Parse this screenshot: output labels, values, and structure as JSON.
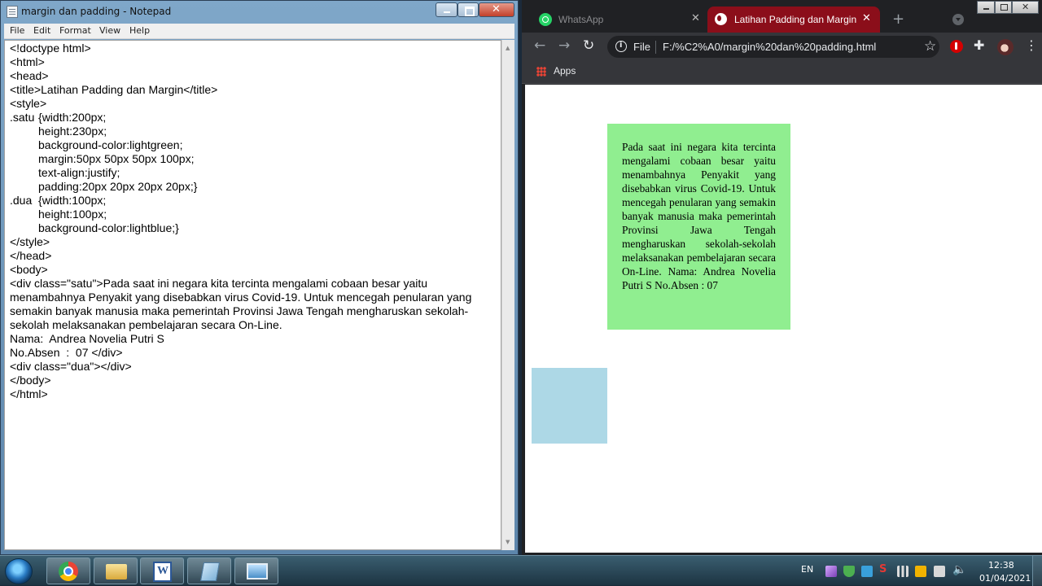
{
  "notepad": {
    "title": "margin dan padding - Notepad",
    "menu": [
      "File",
      "Edit",
      "Format",
      "View",
      "Help"
    ],
    "content": "<!doctype html>\n<html>\n<head>\n<title>Latihan Padding dan Margin</title>\n<style>\n.satu\t{width:200px;\n\theight:230px;\n\tbackground-color:lightgreen;\n\tmargin:50px 50px 50px 100px;\n\ttext-align:justify;\n\tpadding:20px 20px 20px 20px;}\n.dua\t{width:100px;\n\theight:100px;\n\tbackground-color:lightblue;}\n</style>\n</head>\n<body>\n<div class=\"satu\">Pada saat ini negara kita tercinta mengalami cobaan besar yaitu\nmenambahnya Penyakit yang disebabkan virus Covid-19. Untuk mencegah penularan yang\nsemakin banyak manusia maka pemerintah Provinsi Jawa Tengah mengharuskan sekolah-\nsekolah melaksanakan pembelajaran secara On-Line.\nNama:  Andrea Novelia Putri S\nNo.Absen  :  07 </div>\n<div class=\"dua\"></div>\n</body>\n</html>"
  },
  "browser": {
    "tabs": [
      {
        "label": "WhatsApp",
        "active": false,
        "icon": "whatsapp-icon"
      },
      {
        "label": "Latihan Padding dan Margin",
        "active": true,
        "icon": "globe-icon"
      }
    ],
    "omnibox": {
      "scheme": "File",
      "url": "F:/%C2%A0/margin%20dan%20padding.html"
    },
    "bookmarks": {
      "apps_label": "Apps"
    },
    "page": {
      "satu_text": "Pada saat ini negara kita tercinta mengalami cobaan besar yaitu menambahnya Penyakit yang disebabkan virus Covid-19. Untuk mencegah penularan yang semakin banyak manusia maka pemerintah Provinsi Jawa Tengah mengharuskan sekolah-sekolah melaksanakan pembelajaran secara On-Line. Nama: Andrea Novelia Putri S No.Absen : 07",
      "satu_color": "#90ee90",
      "dua_color": "#add8e6"
    },
    "active_tab_color": "#8b0e1a"
  },
  "taskbar": {
    "apps": [
      "chrome-icon",
      "explorer-icon",
      "word-icon",
      "notepad-icon",
      "photo-icon"
    ],
    "language": "EN",
    "time": "12:38",
    "date": "01/04/2021"
  }
}
